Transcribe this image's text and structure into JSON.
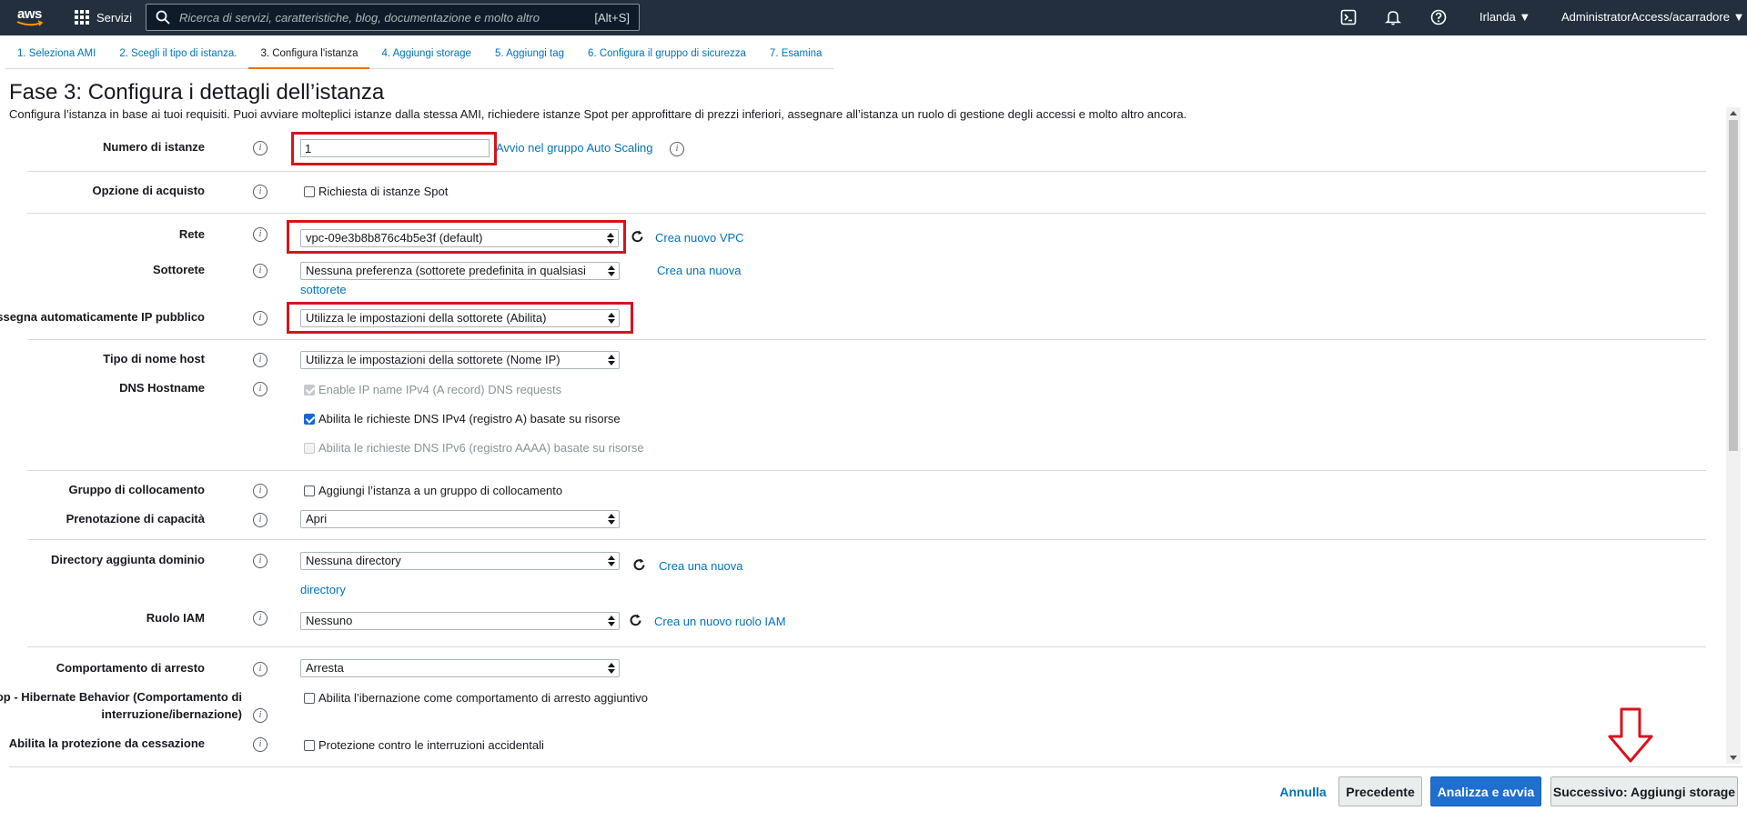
{
  "topbar": {
    "logo_text": "aws",
    "services_label": "Servizi",
    "search_placeholder": "Ricerca di servizi, caratteristiche, blog, documentazione e molto altro",
    "search_shortcut": "[Alt+S]",
    "region": "Irlanda ▼",
    "account": "AdministratorAccess/acarradore ▼"
  },
  "tabs": [
    {
      "label": "1. Seleziona AMI"
    },
    {
      "label": "2. Scegli il tipo di istanza."
    },
    {
      "label": "3. Configura l'istanza"
    },
    {
      "label": "4. Aggiungi storage"
    },
    {
      "label": "5. Aggiungi tag"
    },
    {
      "label": "6. Configura il gruppo di sicurezza"
    },
    {
      "label": "7. Esamina"
    }
  ],
  "page": {
    "title": "Fase 3: Configura i dettagli dell’istanza",
    "subtitle": "Configura l’istanza in base ai tuoi requisiti. Puoi avviare molteplici istanze dalla stessa AMI, richiedere istanze Spot per approfittare di prezzi inferiori, assegnare all’istanza un ruolo di gestione degli accessi e molto altro ancora."
  },
  "form": {
    "num_instances": {
      "label": "Numero di istanze",
      "value": "1",
      "link": "Avvio nel gruppo Auto Scaling"
    },
    "purchase_option": {
      "label": "Opzione di acquisto",
      "checkbox": "Richiesta di istanze Spot"
    },
    "network": {
      "label": "Rete",
      "value": "vpc-09e3b8b876c4b5e3f (default)",
      "link": "Crea nuovo VPC"
    },
    "subnet": {
      "label": "Sottorete",
      "value": "Nessuna preferenza (sottorete predefinita in qualsiasi",
      "link_a": "Crea una nuova",
      "link_b": "sottorete"
    },
    "auto_ip": {
      "label": "Assegna automaticamente IP pubblico",
      "value": "Utilizza le impostazioni della sottorete (Abilita)"
    },
    "hostname_type": {
      "label": "Tipo di nome host",
      "value": "Utilizza le impostazioni della sottorete (Nome IP)"
    },
    "dns_hostname": {
      "label": "DNS Hostname",
      "opt1": "Enable IP name IPv4 (A record) DNS requests",
      "opt2": "Abilita le richieste DNS IPv4 (registro A) basate su risorse",
      "opt3": "Abilita le richieste DNS IPv6 (registro AAAA) basate su risorse"
    },
    "placement_group": {
      "label": "Gruppo di collocamento",
      "checkbox": "Aggiungi l’istanza a un gruppo di collocamento"
    },
    "capacity": {
      "label": "Prenotazione di capacità",
      "value": "Apri"
    },
    "domain_dir": {
      "label": "Directory aggiunta dominio",
      "value": "Nessuna directory",
      "link_a": "Crea una nuova",
      "link_b": "directory"
    },
    "iam_role": {
      "label": "Ruolo IAM",
      "value": "Nessuno",
      "link": "Crea un nuovo ruolo IAM"
    },
    "shutdown": {
      "label": "Comportamento di arresto",
      "value": "Arresta"
    },
    "hibernate": {
      "label": "Stop - Hibernate Behavior (Comportamento di interruzione/ibernazione)",
      "checkbox": "Abilita l’ibernazione come comportamento di arresto aggiuntivo"
    },
    "termination": {
      "label": "Abilita la protezione da cessazione",
      "checkbox": "Protezione contro le interruzioni accidentali"
    }
  },
  "info_glyph": "i",
  "footer": {
    "cancel": "Annulla",
    "previous": "Precedente",
    "review_launch": "Analizza e avvia",
    "next": "Successivo: Aggiungi storage"
  },
  "colors": {
    "topbar": "#232f3e",
    "link": "#0073bb",
    "primary": "#1f6fd1",
    "highlight": "#d9121d",
    "active_tab": "#ec7211"
  }
}
